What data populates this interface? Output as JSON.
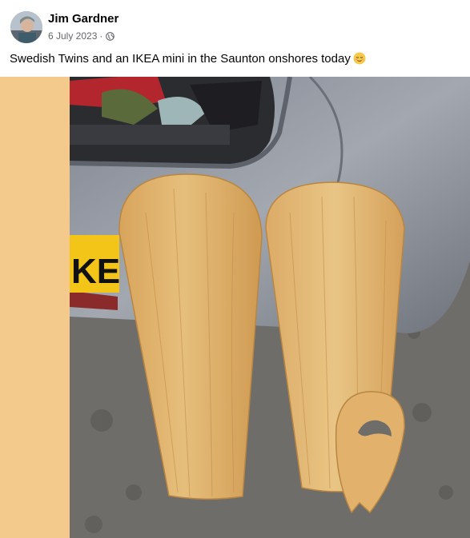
{
  "post": {
    "author": "Jim Gardner",
    "date": "6 July 2023",
    "separator": "·",
    "audience_icon": "globe-icon",
    "caption": "Swedish Twins and an IKEA mini in the Saunton onshores today",
    "caption_emoji": "relieved-face-emoji"
  },
  "photo": {
    "description_icon": "photo",
    "plate_text": "KE"
  },
  "colors": {
    "side_fill": "#f3c98c",
    "wood": "#d9a962",
    "car": "#8b9099",
    "ground": "#6f6d69",
    "plate": "#f2c518"
  }
}
